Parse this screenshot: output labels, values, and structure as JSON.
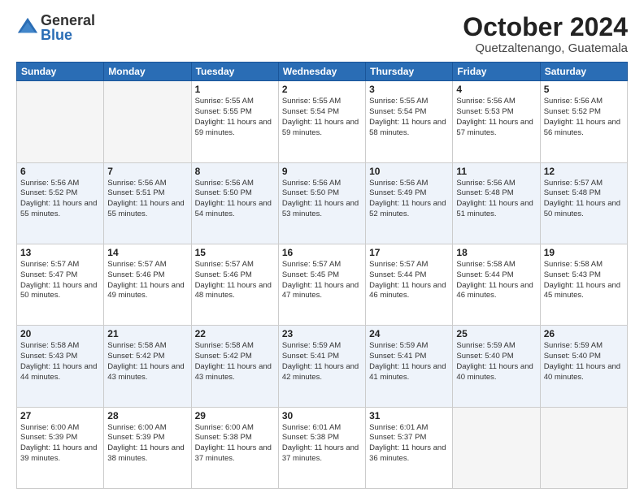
{
  "logo": {
    "general": "General",
    "blue": "Blue"
  },
  "title": "October 2024",
  "subtitle": "Quetzaltenango, Guatemala",
  "weekdays": [
    "Sunday",
    "Monday",
    "Tuesday",
    "Wednesday",
    "Thursday",
    "Friday",
    "Saturday"
  ],
  "weeks": [
    [
      {
        "day": "",
        "empty": true
      },
      {
        "day": "",
        "empty": true
      },
      {
        "day": "1",
        "sunrise": "Sunrise: 5:55 AM",
        "sunset": "Sunset: 5:55 PM",
        "daylight": "Daylight: 11 hours and 59 minutes."
      },
      {
        "day": "2",
        "sunrise": "Sunrise: 5:55 AM",
        "sunset": "Sunset: 5:54 PM",
        "daylight": "Daylight: 11 hours and 59 minutes."
      },
      {
        "day": "3",
        "sunrise": "Sunrise: 5:55 AM",
        "sunset": "Sunset: 5:54 PM",
        "daylight": "Daylight: 11 hours and 58 minutes."
      },
      {
        "day": "4",
        "sunrise": "Sunrise: 5:56 AM",
        "sunset": "Sunset: 5:53 PM",
        "daylight": "Daylight: 11 hours and 57 minutes."
      },
      {
        "day": "5",
        "sunrise": "Sunrise: 5:56 AM",
        "sunset": "Sunset: 5:52 PM",
        "daylight": "Daylight: 11 hours and 56 minutes."
      }
    ],
    [
      {
        "day": "6",
        "sunrise": "Sunrise: 5:56 AM",
        "sunset": "Sunset: 5:52 PM",
        "daylight": "Daylight: 11 hours and 55 minutes."
      },
      {
        "day": "7",
        "sunrise": "Sunrise: 5:56 AM",
        "sunset": "Sunset: 5:51 PM",
        "daylight": "Daylight: 11 hours and 55 minutes."
      },
      {
        "day": "8",
        "sunrise": "Sunrise: 5:56 AM",
        "sunset": "Sunset: 5:50 PM",
        "daylight": "Daylight: 11 hours and 54 minutes."
      },
      {
        "day": "9",
        "sunrise": "Sunrise: 5:56 AM",
        "sunset": "Sunset: 5:50 PM",
        "daylight": "Daylight: 11 hours and 53 minutes."
      },
      {
        "day": "10",
        "sunrise": "Sunrise: 5:56 AM",
        "sunset": "Sunset: 5:49 PM",
        "daylight": "Daylight: 11 hours and 52 minutes."
      },
      {
        "day": "11",
        "sunrise": "Sunrise: 5:56 AM",
        "sunset": "Sunset: 5:48 PM",
        "daylight": "Daylight: 11 hours and 51 minutes."
      },
      {
        "day": "12",
        "sunrise": "Sunrise: 5:57 AM",
        "sunset": "Sunset: 5:48 PM",
        "daylight": "Daylight: 11 hours and 50 minutes."
      }
    ],
    [
      {
        "day": "13",
        "sunrise": "Sunrise: 5:57 AM",
        "sunset": "Sunset: 5:47 PM",
        "daylight": "Daylight: 11 hours and 50 minutes."
      },
      {
        "day": "14",
        "sunrise": "Sunrise: 5:57 AM",
        "sunset": "Sunset: 5:46 PM",
        "daylight": "Daylight: 11 hours and 49 minutes."
      },
      {
        "day": "15",
        "sunrise": "Sunrise: 5:57 AM",
        "sunset": "Sunset: 5:46 PM",
        "daylight": "Daylight: 11 hours and 48 minutes."
      },
      {
        "day": "16",
        "sunrise": "Sunrise: 5:57 AM",
        "sunset": "Sunset: 5:45 PM",
        "daylight": "Daylight: 11 hours and 47 minutes."
      },
      {
        "day": "17",
        "sunrise": "Sunrise: 5:57 AM",
        "sunset": "Sunset: 5:44 PM",
        "daylight": "Daylight: 11 hours and 46 minutes."
      },
      {
        "day": "18",
        "sunrise": "Sunrise: 5:58 AM",
        "sunset": "Sunset: 5:44 PM",
        "daylight": "Daylight: 11 hours and 46 minutes."
      },
      {
        "day": "19",
        "sunrise": "Sunrise: 5:58 AM",
        "sunset": "Sunset: 5:43 PM",
        "daylight": "Daylight: 11 hours and 45 minutes."
      }
    ],
    [
      {
        "day": "20",
        "sunrise": "Sunrise: 5:58 AM",
        "sunset": "Sunset: 5:43 PM",
        "daylight": "Daylight: 11 hours and 44 minutes."
      },
      {
        "day": "21",
        "sunrise": "Sunrise: 5:58 AM",
        "sunset": "Sunset: 5:42 PM",
        "daylight": "Daylight: 11 hours and 43 minutes."
      },
      {
        "day": "22",
        "sunrise": "Sunrise: 5:58 AM",
        "sunset": "Sunset: 5:42 PM",
        "daylight": "Daylight: 11 hours and 43 minutes."
      },
      {
        "day": "23",
        "sunrise": "Sunrise: 5:59 AM",
        "sunset": "Sunset: 5:41 PM",
        "daylight": "Daylight: 11 hours and 42 minutes."
      },
      {
        "day": "24",
        "sunrise": "Sunrise: 5:59 AM",
        "sunset": "Sunset: 5:41 PM",
        "daylight": "Daylight: 11 hours and 41 minutes."
      },
      {
        "day": "25",
        "sunrise": "Sunrise: 5:59 AM",
        "sunset": "Sunset: 5:40 PM",
        "daylight": "Daylight: 11 hours and 40 minutes."
      },
      {
        "day": "26",
        "sunrise": "Sunrise: 5:59 AM",
        "sunset": "Sunset: 5:40 PM",
        "daylight": "Daylight: 11 hours and 40 minutes."
      }
    ],
    [
      {
        "day": "27",
        "sunrise": "Sunrise: 6:00 AM",
        "sunset": "Sunset: 5:39 PM",
        "daylight": "Daylight: 11 hours and 39 minutes."
      },
      {
        "day": "28",
        "sunrise": "Sunrise: 6:00 AM",
        "sunset": "Sunset: 5:39 PM",
        "daylight": "Daylight: 11 hours and 38 minutes."
      },
      {
        "day": "29",
        "sunrise": "Sunrise: 6:00 AM",
        "sunset": "Sunset: 5:38 PM",
        "daylight": "Daylight: 11 hours and 37 minutes."
      },
      {
        "day": "30",
        "sunrise": "Sunrise: 6:01 AM",
        "sunset": "Sunset: 5:38 PM",
        "daylight": "Daylight: 11 hours and 37 minutes."
      },
      {
        "day": "31",
        "sunrise": "Sunrise: 6:01 AM",
        "sunset": "Sunset: 5:37 PM",
        "daylight": "Daylight: 11 hours and 36 minutes."
      },
      {
        "day": "",
        "empty": true
      },
      {
        "day": "",
        "empty": true
      }
    ]
  ]
}
